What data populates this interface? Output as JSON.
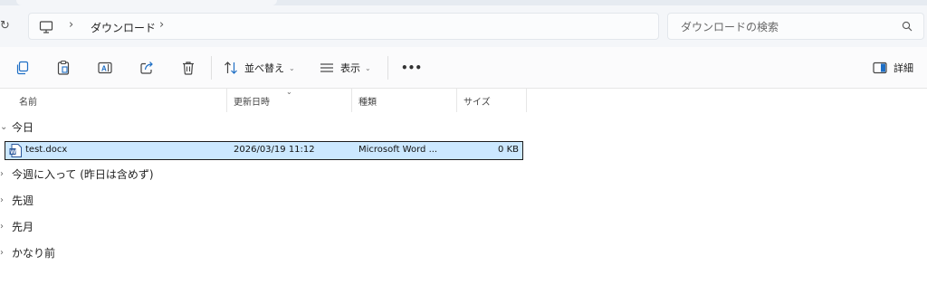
{
  "address": {
    "breadcrumb": [
      "ダウンロード"
    ],
    "search_placeholder": "ダウンロードの検索"
  },
  "toolbar": {
    "sort_label": "並べ替え",
    "view_label": "表示",
    "more_label": "•••",
    "details_label": "詳細"
  },
  "columns": {
    "name": "名前",
    "modified": "更新日時",
    "type": "種類",
    "size": "サイズ"
  },
  "groups": {
    "today": "今日",
    "earlier_this_week": "今週に入って (昨日は含めず)",
    "last_week": "先週",
    "last_month": "先月",
    "long_ago": "かなり前"
  },
  "files": [
    {
      "name": "test.docx",
      "modified": "2026/03/19 11:12",
      "type": "Microsoft Word ...",
      "size": "0 KB"
    }
  ],
  "colors": {
    "selection": "#cce8ff",
    "word_blue": "#2b579a"
  }
}
